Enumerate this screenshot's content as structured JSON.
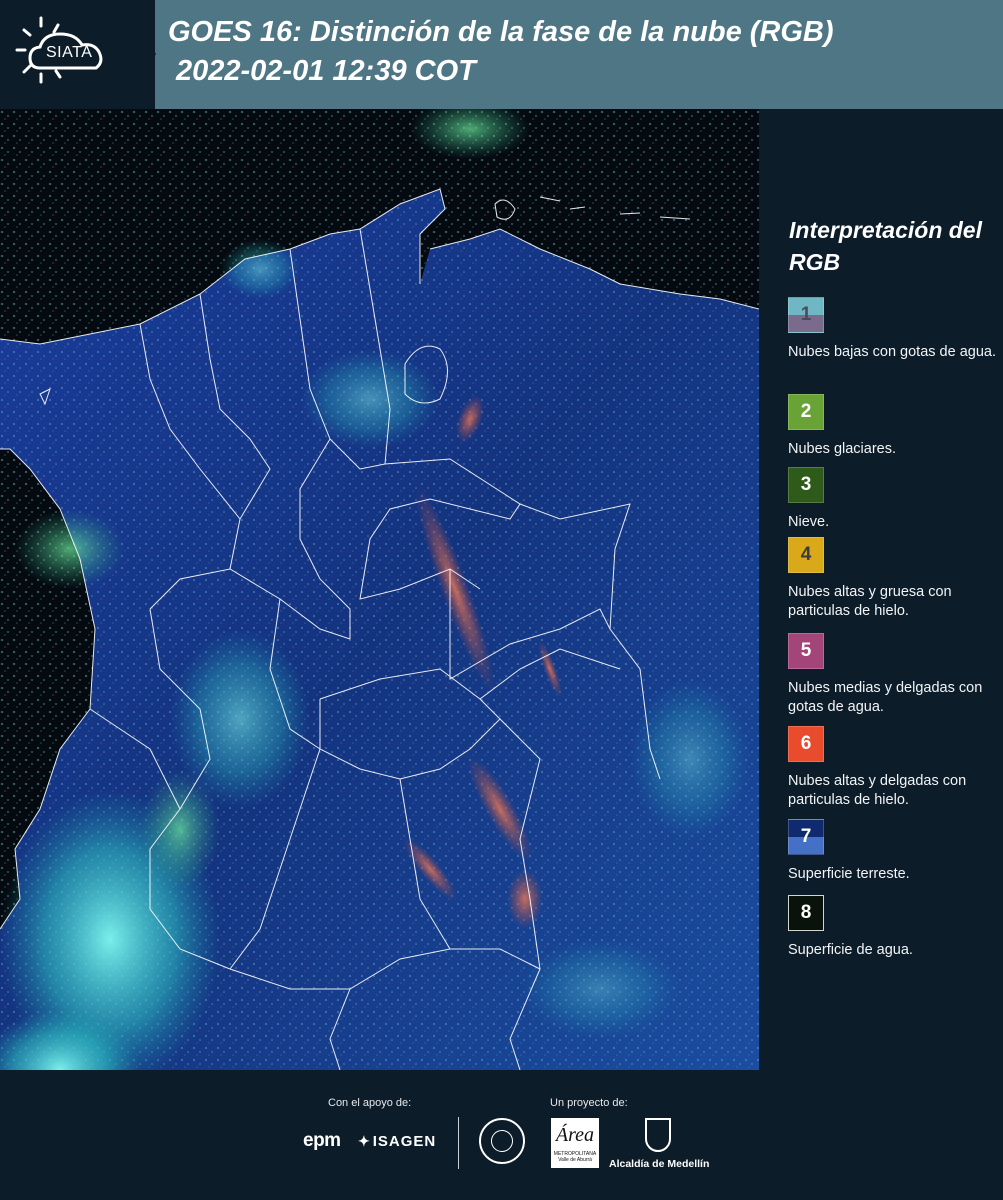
{
  "header": {
    "logo_text": "SIATA",
    "title_line1": "GOES 16: Distinción de la fase de la nube (RGB)",
    "title_line2": "2022-02-01 12:39 COT"
  },
  "legend": {
    "title": "Interpretación del RGB",
    "items": [
      {
        "num": "1",
        "top_color": "#6fb7c4",
        "bottom_color": "#7a6a8c",
        "num_color": "#4a4a5a",
        "desc": "Nubes bajas con gotas de agua."
      },
      {
        "num": "2",
        "top_color": "#6aa335",
        "bottom_color": "#6aa335",
        "num_color": "#ffffff",
        "desc": "Nubes glaciares."
      },
      {
        "num": "3",
        "top_color": "#2e5a1a",
        "bottom_color": "#2e5a1a",
        "num_color": "#ffffff",
        "desc": "Nieve."
      },
      {
        "num": "4",
        "top_color": "#d9a91a",
        "bottom_color": "#d9a91a",
        "num_color": "#3a3a3a",
        "desc": "Nubes altas y gruesa con particulas de hielo."
      },
      {
        "num": "5",
        "top_color": "#a4457a",
        "bottom_color": "#a4457a",
        "num_color": "#ffffff",
        "desc": "Nubes medias y delgadas con gotas de agua."
      },
      {
        "num": "6",
        "top_color": "#e84c2c",
        "bottom_color": "#e84c2c",
        "num_color": "#ffffff",
        "desc": "Nubes altas y delgadas con particulas de hielo."
      },
      {
        "num": "7",
        "top_color": "#0f2a6e",
        "bottom_color": "#4470c6",
        "num_color": "#ffffff",
        "desc": "Superficie terreste."
      },
      {
        "num": "8",
        "top_color": "#0a120c",
        "bottom_color": "#0a120c",
        "num_color": "#ffffff",
        "desc": "Superficie de agua."
      }
    ]
  },
  "footer": {
    "support_label": "Con el apoyo de:",
    "project_label": "Un proyecto de:",
    "epm": "epm",
    "isagen": "ISAGEN",
    "area_metropolitana": "Área",
    "area_subtitle": "METROPOLITANA Valle de Aburrá",
    "alcaldia": "Alcaldía de Medellín"
  },
  "map": {
    "ocean_color": "#050a10",
    "land_color": "#163a8c",
    "cloud_color": "#3fd6d0",
    "ice_cloud_color": "#e86a4a",
    "border_color": "#ffffff"
  }
}
